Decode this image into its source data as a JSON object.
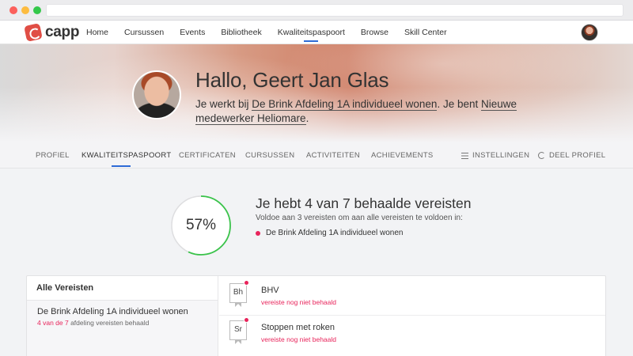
{
  "app": {
    "logo_text": "capp"
  },
  "nav": {
    "items": [
      {
        "label": "Home"
      },
      {
        "label": "Cursussen"
      },
      {
        "label": "Events"
      },
      {
        "label": "Bibliotheek"
      },
      {
        "label": "Kwaliteitspaspoort",
        "active": true
      },
      {
        "label": "Browse"
      },
      {
        "label": "Skill Center"
      }
    ]
  },
  "profile": {
    "greeting": "Hallo, Geert Jan Glas",
    "sub_prefix": "Je werkt bij ",
    "department": "De Brink Afdeling 1A individueel wonen",
    "sub_middle": ". Je bent ",
    "role": "Nieuwe medewerker Heliomare",
    "sub_suffix": "."
  },
  "tabs": {
    "profiel": "PROFIEL",
    "kwaliteitspaspoort": "KWALITEITSPASPOORT",
    "certificaten": "CERTIFICATEN",
    "cursussen": "CURSUSSEN",
    "activiteiten": "ACTIVITEITEN",
    "achievements": "ACHIEVEMENTS",
    "instellingen": "INSTELLINGEN",
    "deel_profiel": "DEEL PROFIEL"
  },
  "summary": {
    "percent_label": "57%",
    "progress_fraction": 0.57,
    "title": "Je hebt 4 van 7 behaalde vereisten",
    "subtitle": "Voldoe aan 3 vereisten om aan alle vereisten te voldoen in:",
    "item": "De Brink Afdeling 1A individueel wonen",
    "progress_color": "#3ac34a"
  },
  "requirements": {
    "header": "Alle Vereisten",
    "group": {
      "title": "De Brink Afdeling 1A individueel wonen",
      "count": "4 van de 7",
      "meta": " afdeling vereisten behaald"
    },
    "items": [
      {
        "badge": "Bh",
        "title": "BHV",
        "status": "vereiste nog niet behaald"
      },
      {
        "badge": "Sr",
        "title": "Stoppen met roken",
        "status": "vereiste nog niet behaald"
      }
    ]
  },
  "colors": {
    "accent": "#2d6bd6",
    "alert": "#e8245b",
    "brand": "#e04e45"
  }
}
